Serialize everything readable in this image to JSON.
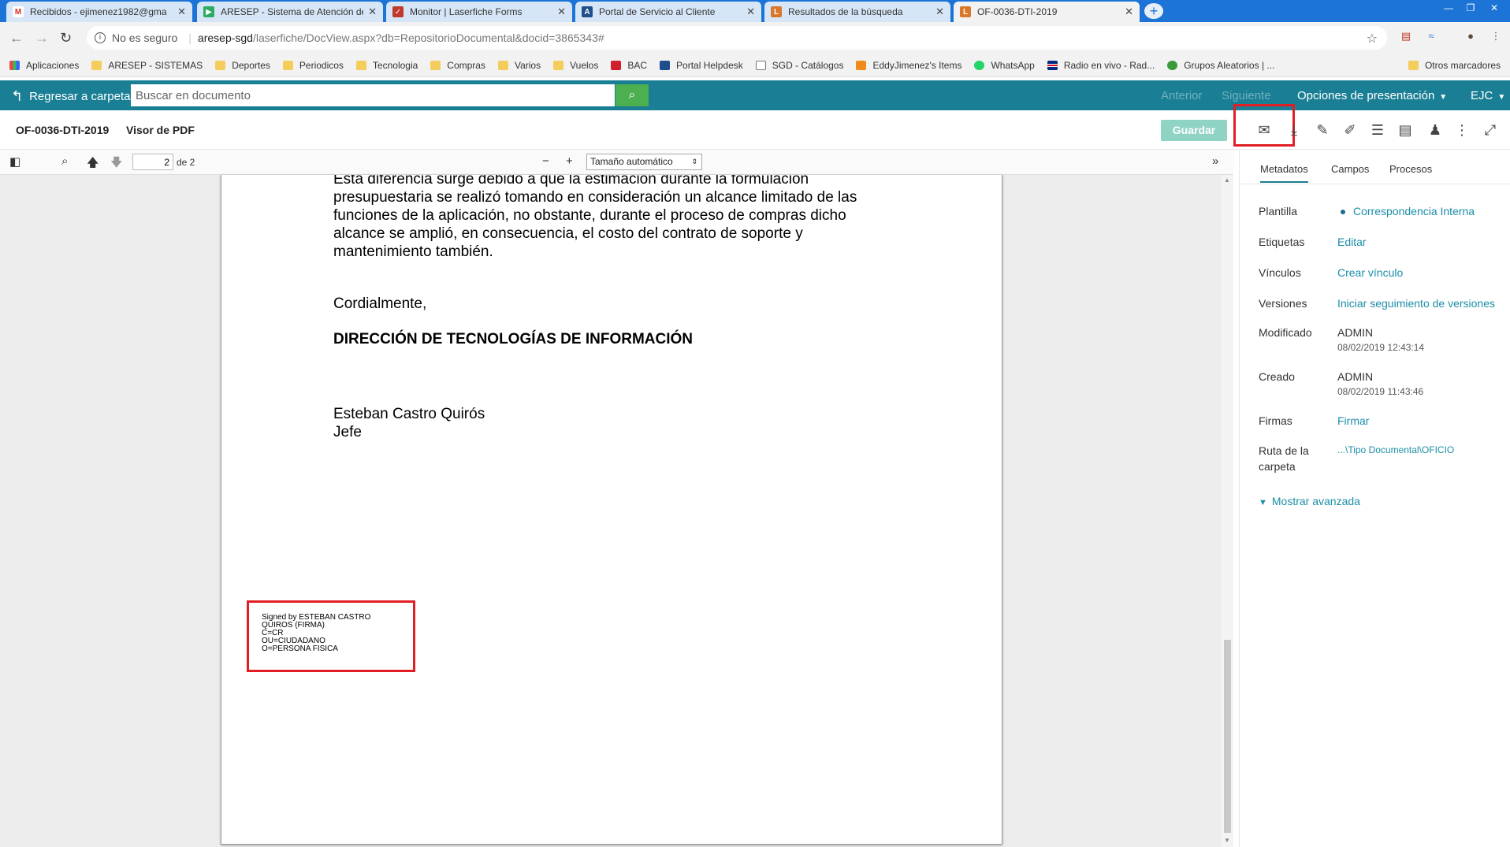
{
  "browser": {
    "tabs": [
      {
        "title": "Recibidos - ejimenez1982@gma",
        "icon": "gmail-icon",
        "color": "#d93025",
        "glyph": "M"
      },
      {
        "title": "ARESEP - Sistema de Atención de",
        "icon": "aresep-icon",
        "color": "#2eaa63",
        "glyph": "▶"
      },
      {
        "title": "Monitor | Laserfiche Forms",
        "icon": "laserfiche-forms-icon",
        "color": "#c0392b",
        "glyph": "✓"
      },
      {
        "title": "Portal de Servicio al Cliente",
        "icon": "portal-icon",
        "color": "#1f4e8c",
        "glyph": "A"
      },
      {
        "title": "Resultados de la búsqueda",
        "icon": "laserfiche-icon",
        "color": "#d9772b",
        "glyph": "L"
      },
      {
        "title": "OF-0036-DTI-2019",
        "icon": "laserfiche-icon",
        "color": "#d9772b",
        "glyph": "L"
      }
    ],
    "address": {
      "security": "No es seguro",
      "separator": "|",
      "host": "aresep-sgd",
      "path": "/laserfiche/DocView.aspx?db=RepositorioDocumental&docid=3865343#"
    },
    "bookmarks": [
      {
        "label": "Aplicaciones",
        "icon": "apps-icon"
      },
      {
        "label": "ARESEP - SISTEMAS",
        "icon": "folder-icon"
      },
      {
        "label": "Deportes",
        "icon": "folder-icon"
      },
      {
        "label": "Periodicos",
        "icon": "folder-icon"
      },
      {
        "label": "Tecnologia",
        "icon": "folder-icon"
      },
      {
        "label": "Compras",
        "icon": "folder-icon"
      },
      {
        "label": "Varios",
        "icon": "folder-icon"
      },
      {
        "label": "Vuelos",
        "icon": "folder-icon"
      },
      {
        "label": "BAC",
        "icon": "bac-icon"
      },
      {
        "label": "Portal Helpdesk",
        "icon": "helpdesk-icon"
      },
      {
        "label": "SGD - Catálogos",
        "icon": "page-icon"
      },
      {
        "label": "EddyJimenez's Items",
        "icon": "play-icon"
      },
      {
        "label": "WhatsApp",
        "icon": "whatsapp-icon"
      },
      {
        "label": "Radio en vivo - Rad...",
        "icon": "radio-icon"
      },
      {
        "label": "Grupos Aleatorios | ...",
        "icon": "groups-icon"
      }
    ],
    "other_bookmarks": "Otros marcadores"
  },
  "app": {
    "back_label": "Regresar a carpeta",
    "search_placeholder": "Buscar en documento",
    "prev": "Anterior",
    "next": "Siguiente",
    "display_options": "Opciones de presentación",
    "user": "EJC",
    "accent": "#1a7f94"
  },
  "doc": {
    "title": "OF-0036-DTI-2019",
    "viewer": "Visor de PDF",
    "save": "Guardar"
  },
  "pdf": {
    "page_current": "2",
    "page_of": "de 2",
    "zoom": "Tamaño automático",
    "paragraph_lines": [
      "Esta diferencia surge debido a que la estimación durante la formulación",
      "presupuestaria se realizó tomando en consideración un alcance limitado de las",
      "funciones de la aplicación, no obstante, durante el proceso de compras dicho",
      "alcance se amplió, en consecuencia, el costo del contrato de soporte y",
      "mantenimiento también."
    ],
    "closing": "Cordialmente,",
    "department": "DIRECCIÓN DE TECNOLOGÍAS DE INFORMACIÓN",
    "signer_name": "Esteban Castro Quirós",
    "signer_role": "Jefe",
    "signature_lines": [
      "Signed by ESTEBAN CASTRO",
      "QUIROS (FIRMA)",
      "C=CR",
      "OU=CIUDADANO",
      "O=PERSONA FISICA"
    ]
  },
  "panel": {
    "tabs": [
      "Metadatos",
      "Campos",
      "Procesos"
    ],
    "rows": {
      "plantilla": {
        "label": "Plantilla",
        "value": "Correspondencia Interna"
      },
      "etiquetas": {
        "label": "Etiquetas",
        "value": "Editar"
      },
      "vinculos": {
        "label": "Vínculos",
        "value": "Crear vínculo"
      },
      "versiones": {
        "label": "Versiones",
        "value": "Iniciar seguimiento de versiones"
      },
      "modificado": {
        "label": "Modificado",
        "value": "ADMIN",
        "date": "08/02/2019 12:43:14"
      },
      "creado": {
        "label": "Creado",
        "value": "ADMIN",
        "date": "08/02/2019 11:43:46"
      },
      "firmas": {
        "label": "Firmas",
        "value": "Firmar"
      },
      "ruta": {
        "label1": "Ruta de la",
        "label2": "carpeta",
        "value": "...\\Tipo Documental\\OFICIO"
      }
    },
    "advanced": "Mostrar avanzada"
  }
}
